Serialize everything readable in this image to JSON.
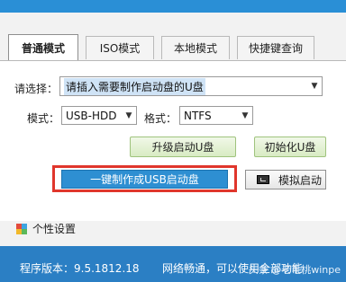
{
  "tabs": [
    {
      "label": "普通模式"
    },
    {
      "label": "ISO模式"
    },
    {
      "label": "本地模式"
    },
    {
      "label": "快捷键查询"
    }
  ],
  "device": {
    "label": "请选择：",
    "value": "请插入需要制作启动盘的U盘"
  },
  "mode": {
    "label": "模式：",
    "value": "USB-HDD"
  },
  "format": {
    "label": "格式：",
    "value": "NTFS"
  },
  "buttons": {
    "upgrade": "升级启动U盘",
    "init": "初始化U盘",
    "make": "一键制作成USB启动盘",
    "simulate": "模拟启动"
  },
  "personal_settings": "个性设置",
  "status": {
    "version": "程序版本：9.5.1812.18",
    "network": "网络畅通，可以使用全部功能",
    "watermark": "头条 @老毛桃winpe"
  },
  "colors": {
    "accent": "#2b7fc4",
    "primary_button": "#2e8fd2",
    "highlight_frame": "#e0362c"
  }
}
